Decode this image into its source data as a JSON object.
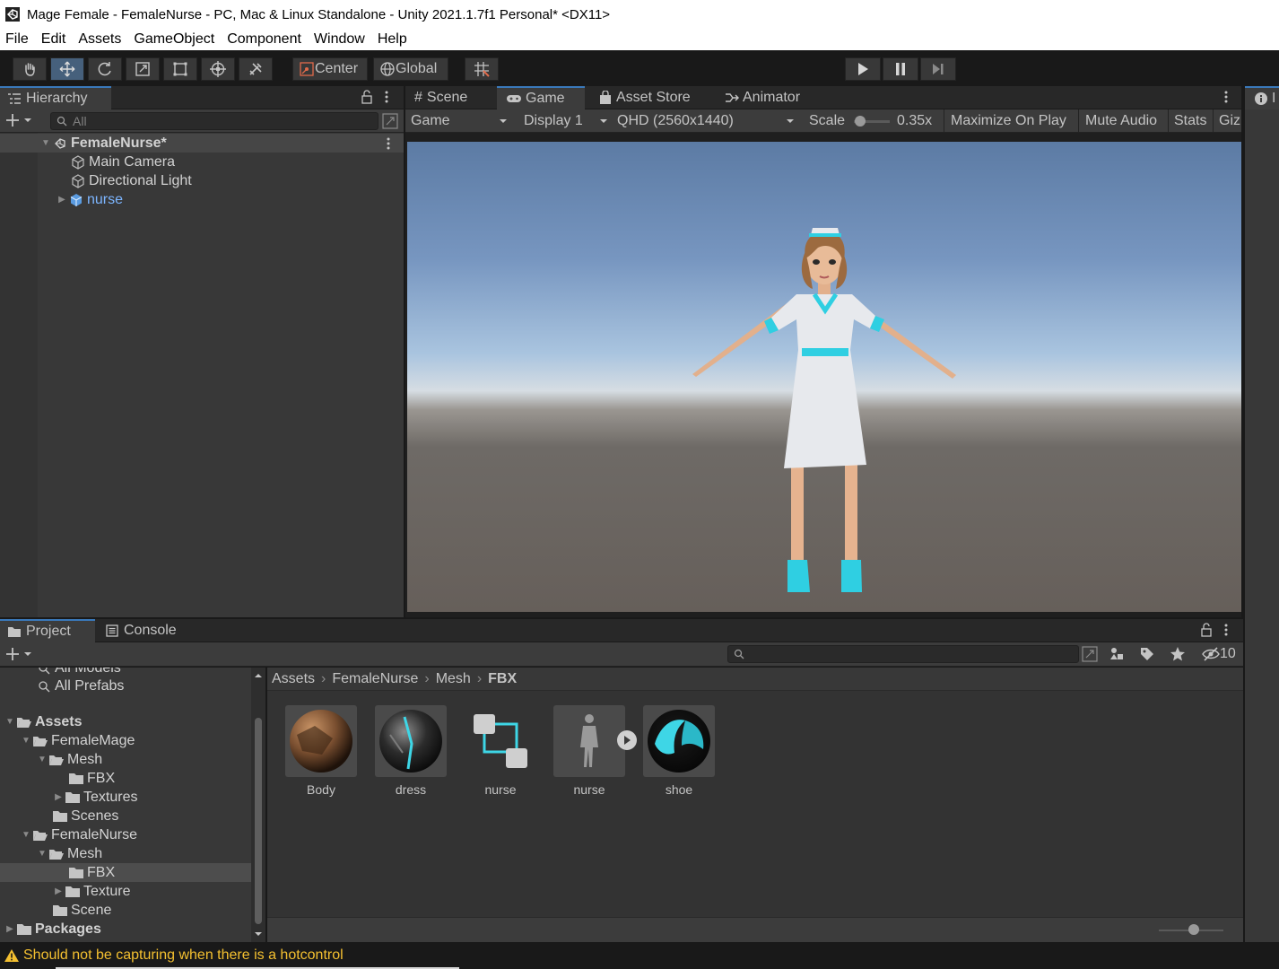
{
  "window": {
    "title": "Mage Female - FemaleNurse - PC, Mac & Linux Standalone - Unity 2021.1.7f1 Personal* <DX11>"
  },
  "menu": [
    "File",
    "Edit",
    "Assets",
    "GameObject",
    "Component",
    "Window",
    "Help"
  ],
  "toolbar": {
    "pivot_label": "Center",
    "space_label": "Global"
  },
  "hierarchy": {
    "tab_label": "Hierarchy",
    "search_placeholder": "All",
    "scene_name": "FemaleNurse*",
    "items": [
      {
        "label": "Main Camera",
        "icon": "gameobject-icon"
      },
      {
        "label": "Directional Light",
        "icon": "gameobject-icon"
      },
      {
        "label": "nurse",
        "icon": "prefab-icon"
      }
    ]
  },
  "center_tabs": [
    "Scene",
    "Game",
    "Asset Store",
    "Animator"
  ],
  "game_toolbar": {
    "mode": "Game",
    "display": "Display 1",
    "resolution": "QHD (2560x1440)",
    "scale_label": "Scale",
    "scale_value": "0.35x",
    "scale_slider_fraction": 0.05,
    "maximize": "Maximize On Play",
    "mute": "Mute Audio",
    "stats": "Stats",
    "gizmos": "Giz"
  },
  "inspector_tab": {
    "label": "I"
  },
  "bottom_tabs": [
    "Project",
    "Console"
  ],
  "project": {
    "hidden_count": "10",
    "tree": {
      "all_models": "All Models",
      "all_prefabs": "All Prefabs",
      "assets": "Assets",
      "female_mage": "FemaleMage",
      "fm_mesh": "Mesh",
      "fm_fbx": "FBX",
      "fm_textures": "Textures",
      "fm_scenes": "Scenes",
      "female_nurse": "FemaleNurse",
      "fn_mesh": "Mesh",
      "fn_fbx": "FBX",
      "fn_texture": "Texture",
      "fn_scene": "Scene",
      "packages": "Packages"
    },
    "breadcrumb": [
      "Assets",
      "FemaleNurse",
      "Mesh",
      "FBX"
    ],
    "assets": [
      {
        "name": "Body",
        "kind": "material-brown-icon"
      },
      {
        "name": "dress",
        "kind": "material-dark-icon"
      },
      {
        "name": "nurse",
        "kind": "avatar-icon"
      },
      {
        "name": "nurse",
        "kind": "model-icon"
      },
      {
        "name": "shoe",
        "kind": "material-teal-icon"
      }
    ],
    "zoom_slider_fraction": 0.55
  },
  "status": {
    "message": "Should not be capturing when there is a hotcontrol"
  },
  "colors": {
    "accent": "#3a79bb",
    "warning": "#f4c030",
    "prefab_blue": "#7cb5ff",
    "teal": "#3ed6e6"
  }
}
